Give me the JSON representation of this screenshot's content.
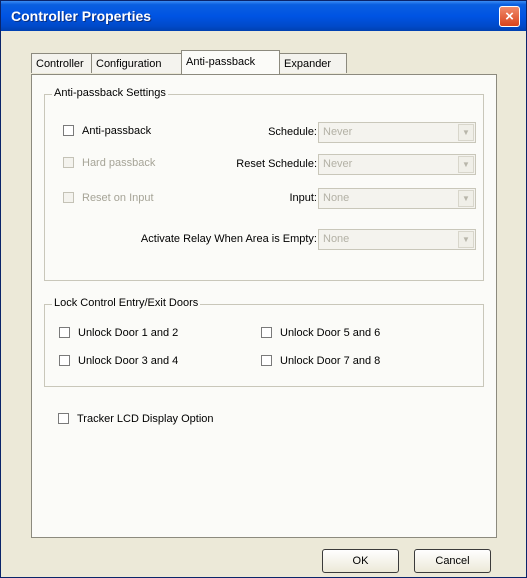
{
  "window": {
    "title": "Controller Properties",
    "close_icon": "×"
  },
  "tabs": [
    {
      "label": "Controller"
    },
    {
      "label": "Configuration"
    },
    {
      "label": "Anti-passback",
      "active": true
    },
    {
      "label": "Expander"
    }
  ],
  "antipassback": {
    "group_label": "Anti-passback Settings",
    "antipassback_label": "Anti-passback",
    "hard_passback_label": "Hard passback",
    "reset_on_input_label": "Reset on Input",
    "schedule_label": "Schedule:",
    "schedule_value": "Never",
    "reset_schedule_label": "Reset Schedule:",
    "reset_schedule_value": "Never",
    "input_label": "Input:",
    "input_value": "None",
    "relay_label": "Activate Relay When Area is Empty:",
    "relay_value": "None"
  },
  "lock_control": {
    "group_label": "Lock Control Entry/Exit Doors",
    "door_1_2": "Unlock Door 1 and 2",
    "door_3_4": "Unlock Door 3 and 4",
    "door_5_6": "Unlock Door 5 and 6",
    "door_7_8": "Unlock Door 7 and 8"
  },
  "tracker_lcd_label": "Tracker LCD Display Option",
  "buttons": {
    "ok": "OK",
    "cancel": "Cancel"
  }
}
